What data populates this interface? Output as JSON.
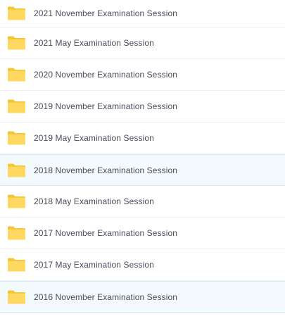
{
  "folders": [
    {
      "label": "2021 November Examination Session",
      "icon": "folder-icon",
      "highlighted": false
    },
    {
      "label": "2021 May Examination Session",
      "icon": "folder-icon",
      "highlighted": false
    },
    {
      "label": "2020 November Examination Session",
      "icon": "folder-icon",
      "highlighted": false
    },
    {
      "label": "2019 November Examination Session",
      "icon": "folder-icon",
      "highlighted": false
    },
    {
      "label": "2019 May Examination Session",
      "icon": "folder-icon",
      "highlighted": false
    },
    {
      "label": "2018 November Examination Session",
      "icon": "folder-icon",
      "highlighted": true
    },
    {
      "label": "2018 May Examination Session",
      "icon": "folder-icon",
      "highlighted": false
    },
    {
      "label": "2017 November Examination Session",
      "icon": "folder-icon",
      "highlighted": false
    },
    {
      "label": "2017 May Examination Session",
      "icon": "folder-icon",
      "highlighted": false
    },
    {
      "label": "2016 November Examination Session",
      "icon": "folder-icon",
      "highlighted": true
    }
  ],
  "colors": {
    "folder_back": "#f5c531",
    "folder_front": "#ffd862",
    "text": "#454c59",
    "row_highlight": "#f3fafd",
    "row_border": "#eef0f2"
  }
}
